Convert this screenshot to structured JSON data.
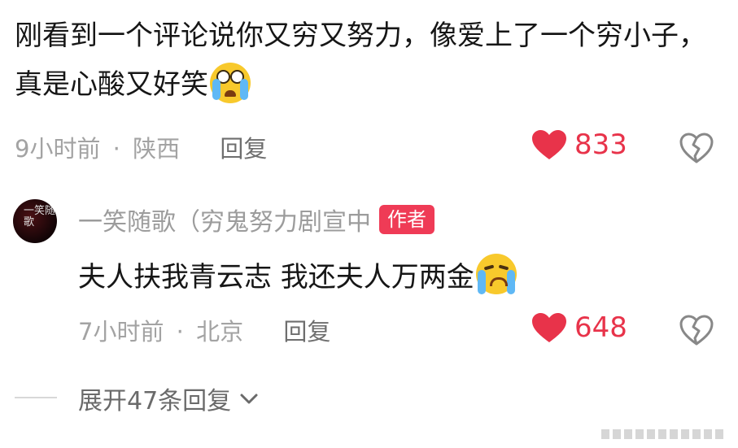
{
  "comment": {
    "text": "刚看到一个评论说你又穷又努力，像爱上了一个穷小子，真是心酸又好笑",
    "time": "9小时前",
    "location": "陕西",
    "separator": "·",
    "reply_label": "回复",
    "likes": "833"
  },
  "reply": {
    "author": "一笑随歌（穷鬼努力剧宣中",
    "badge": "作者",
    "avatar_text": "一笑随歌",
    "text": "夫人扶我青云志 我还夫人万两金",
    "time": "7小时前",
    "location": "北京",
    "separator": "·",
    "reply_label": "回复",
    "likes": "648"
  },
  "expand_label": "展开47条回复",
  "colors": {
    "accent": "#e8334a",
    "badge": "#ef3b56",
    "meta": "#a3a3a3"
  }
}
